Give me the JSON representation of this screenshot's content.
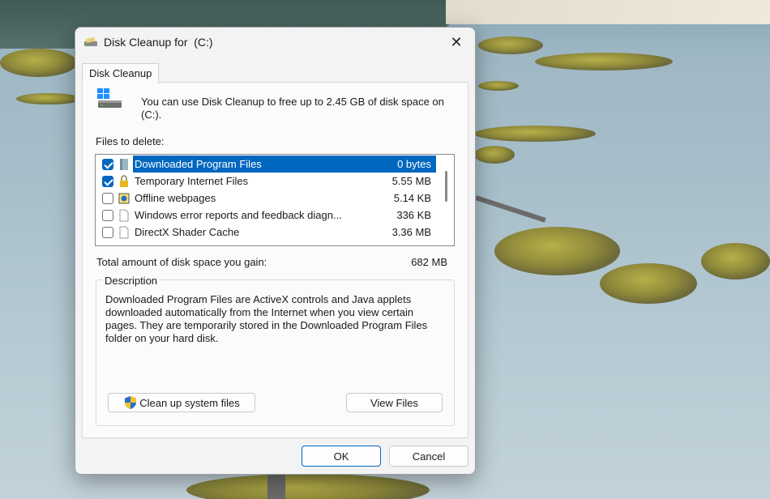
{
  "window": {
    "title": "Disk Cleanup for  (C:)",
    "tab_label": "Disk Cleanup"
  },
  "intro_text": "You can use Disk Cleanup to free up to 2.45 GB of disk space on (C:).",
  "files_label": "Files to delete:",
  "files": [
    {
      "name": "Downloaded Program Files",
      "size": "0 bytes",
      "checked": true,
      "selected": true,
      "icon": "folder-icon"
    },
    {
      "name": "Temporary Internet Files",
      "size": "5.55 MB",
      "checked": true,
      "selected": false,
      "icon": "lock-icon"
    },
    {
      "name": "Offline webpages",
      "size": "5.14 KB",
      "checked": false,
      "selected": false,
      "icon": "offline-webpages-icon"
    },
    {
      "name": "Windows error reports and feedback diagn...",
      "size": "336 KB",
      "checked": false,
      "selected": false,
      "icon": "file-icon"
    },
    {
      "name": "DirectX Shader Cache",
      "size": "3.36 MB",
      "checked": false,
      "selected": false,
      "icon": "file-icon"
    }
  ],
  "total": {
    "label": "Total amount of disk space you gain:",
    "value": "682 MB"
  },
  "description": {
    "legend": "Description",
    "text": "Downloaded Program Files are ActiveX controls and Java applets downloaded automatically from the Internet when you view certain pages. They are temporarily stored in the Downloaded Program Files folder on your hard disk."
  },
  "buttons": {
    "clean_system": "Clean up system files",
    "view_files": "View Files",
    "ok": "OK",
    "cancel": "Cancel"
  },
  "colors": {
    "accent": "#0067c0"
  }
}
